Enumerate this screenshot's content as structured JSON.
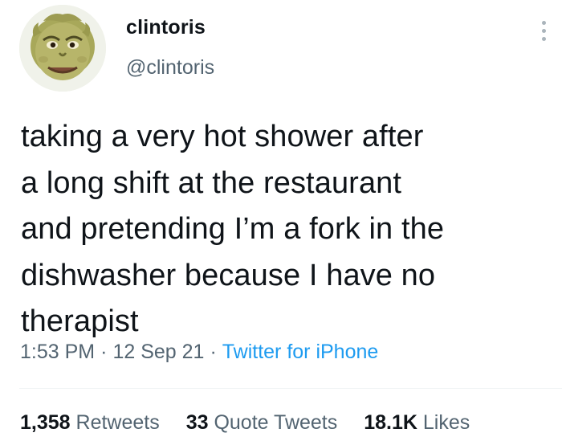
{
  "author": {
    "display_name": "clintoris",
    "handle": "@clintoris",
    "avatar_icon": "grinch-face-avatar"
  },
  "tweet": {
    "text": "taking a very hot shower after\na long shift at the restaurant\nand pretending I’m a fork in the\ndishwasher because I have no\ntherapist",
    "time": "1:53 PM",
    "date": "12 Sep 21",
    "separator": "·",
    "source": "Twitter for iPhone"
  },
  "stats": {
    "retweets_count": "1,358",
    "retweets_label": "Retweets",
    "quote_tweets_count": "33",
    "quote_tweets_label": "Quote Tweets",
    "likes_count": "18.1K",
    "likes_label": "Likes"
  },
  "colors": {
    "text_primary": "#0f1419",
    "text_secondary": "#536471",
    "link_blue": "#1d9bf0",
    "divider": "#eff3f4"
  },
  "icons": {
    "more": "more-options-icon"
  }
}
